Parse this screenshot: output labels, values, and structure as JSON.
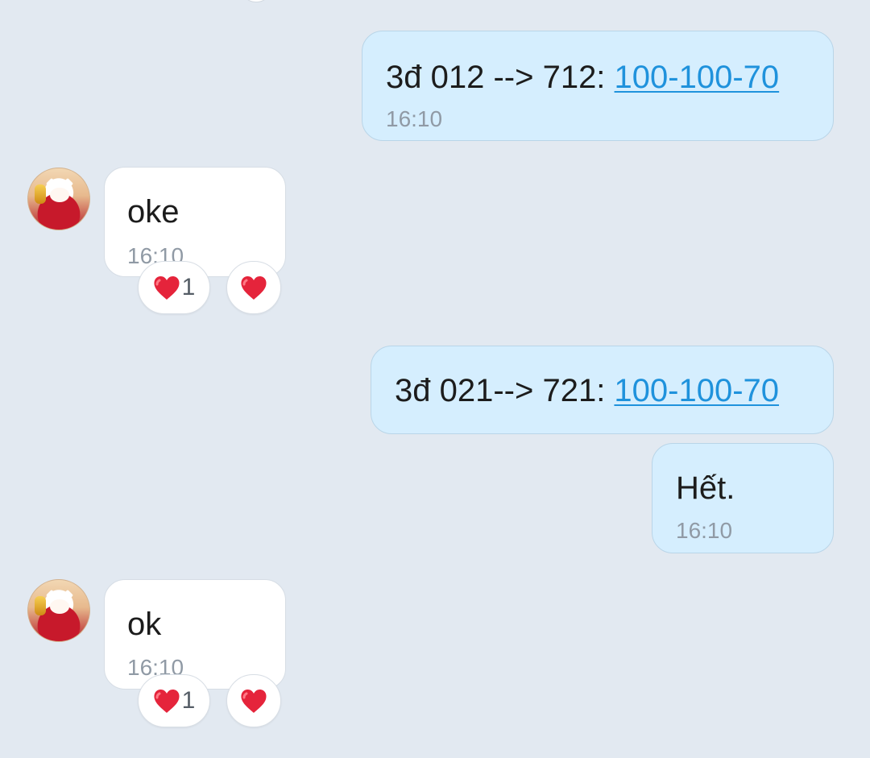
{
  "messages": [
    {
      "kind": "sent",
      "text_prefix": "3đ 012 --> 712: ",
      "link_text": "100-100-70",
      "time": "16:10"
    },
    {
      "kind": "received",
      "text": "oke",
      "time": "16:10",
      "reaction_count": "1"
    },
    {
      "kind": "sent",
      "text_prefix": "3đ 021--> 721: ",
      "link_text": "100-100-70"
    },
    {
      "kind": "sent",
      "text": "Hết.",
      "time": "16:10"
    },
    {
      "kind": "received",
      "text": "ok",
      "time": "16:10",
      "reaction_count": "1"
    }
  ],
  "icons": {
    "reaction": "heart-icon",
    "avatar": "lucky-cat-avatar"
  },
  "colors": {
    "background": "#e2e9f1",
    "sent_bubble": "#d5eefe",
    "received_bubble": "#ffffff",
    "link": "#1f92dc",
    "time": "#909aa5",
    "heart": "#e5243b"
  }
}
